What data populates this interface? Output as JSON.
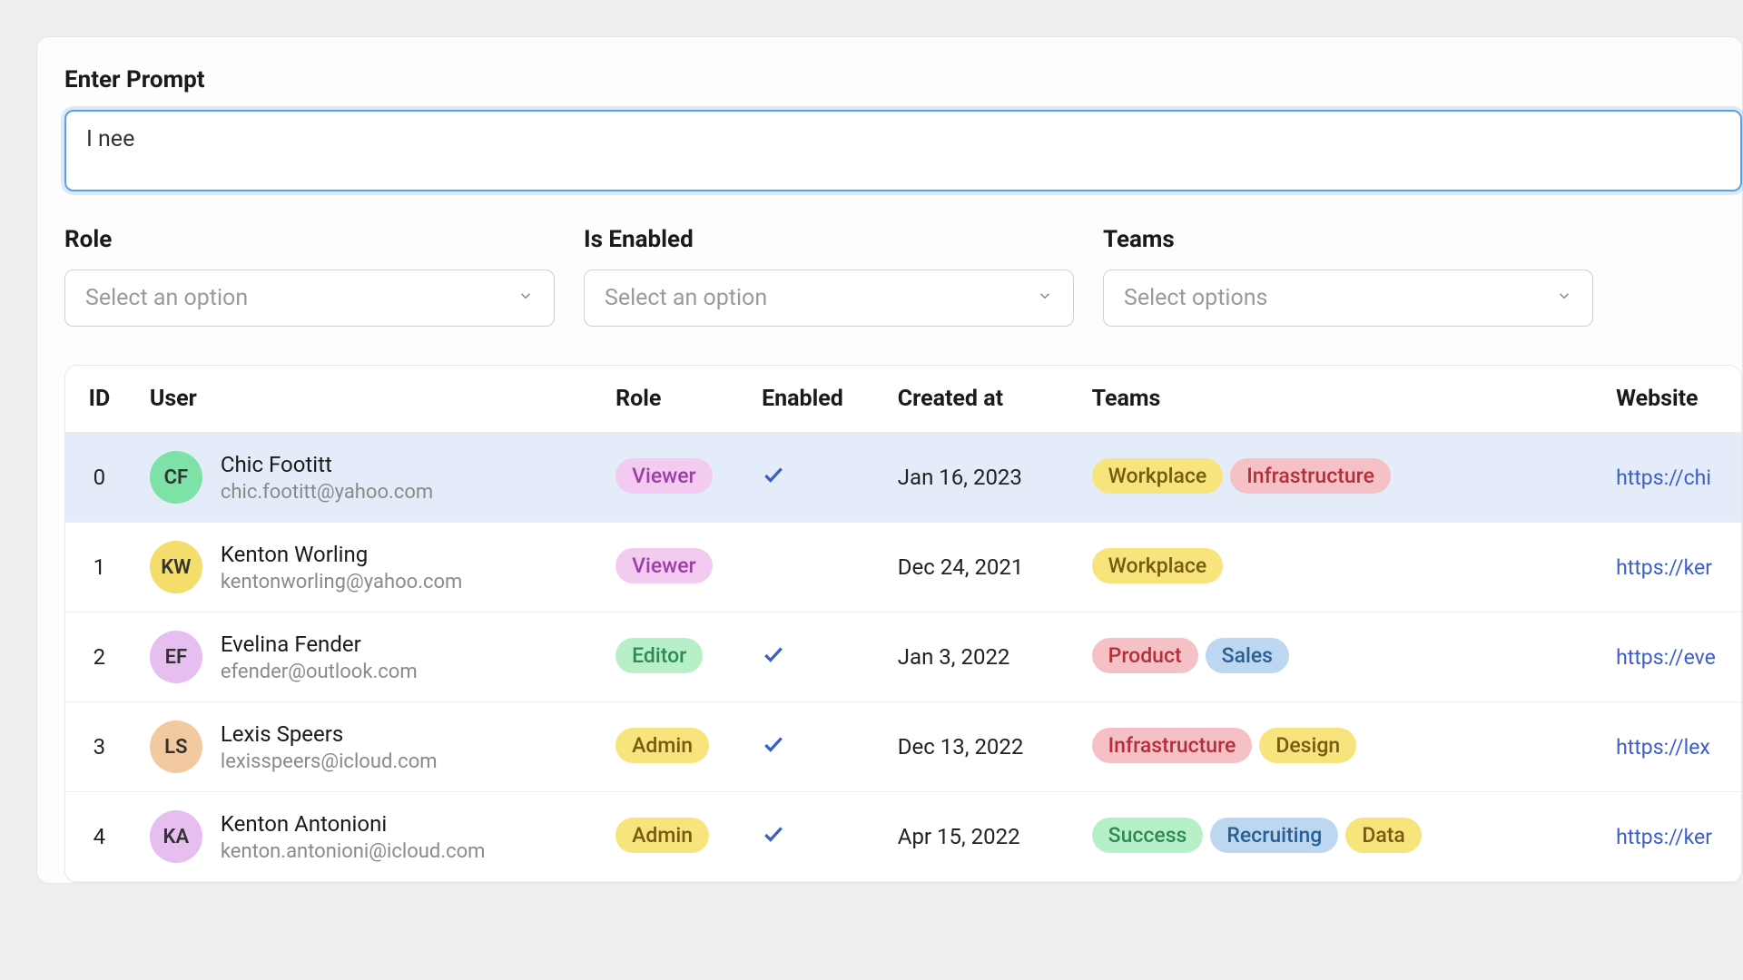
{
  "prompt": {
    "label": "Enter Prompt",
    "value": "I nee"
  },
  "filters": {
    "role": {
      "label": "Role",
      "placeholder": "Select an option"
    },
    "enabled": {
      "label": "Is Enabled",
      "placeholder": "Select an option"
    },
    "teams": {
      "label": "Teams",
      "placeholder": "Select options"
    }
  },
  "table": {
    "headers": {
      "id": "ID",
      "user": "User",
      "role": "Role",
      "enabled": "Enabled",
      "created": "Created at",
      "teams": "Teams",
      "website": "Website"
    },
    "rows": [
      {
        "id": "0",
        "initials": "CF",
        "avatar_bg": "#7ee2a8",
        "name": "Chic Footitt",
        "email": "chic.footitt@yahoo.com",
        "role": "Viewer",
        "role_bg": "#f3cbf0",
        "role_fg": "#9b3fa5",
        "enabled": true,
        "created": "Jan 16, 2023",
        "teams": [
          {
            "label": "Workplace",
            "bg": "#f7e47c",
            "fg": "#7a5a10"
          },
          {
            "label": "Infrastructure",
            "bg": "#f6c0c7",
            "fg": "#b3303b"
          }
        ],
        "website": "https://chi",
        "selected": true
      },
      {
        "id": "1",
        "initials": "KW",
        "avatar_bg": "#f4dd6b",
        "name": "Kenton Worling",
        "email": "kentonworling@yahoo.com",
        "role": "Viewer",
        "role_bg": "#f3cbf0",
        "role_fg": "#9b3fa5",
        "enabled": false,
        "created": "Dec 24, 2021",
        "teams": [
          {
            "label": "Workplace",
            "bg": "#f7e47c",
            "fg": "#7a5a10"
          }
        ],
        "website": "https://ker",
        "selected": false
      },
      {
        "id": "2",
        "initials": "EF",
        "avatar_bg": "#e6bff0",
        "name": "Evelina Fender",
        "email": "efender@outlook.com",
        "role": "Editor",
        "role_bg": "#b7f0c8",
        "role_fg": "#2f8a52",
        "enabled": true,
        "created": "Jan 3, 2022",
        "teams": [
          {
            "label": "Product",
            "bg": "#f6c0c7",
            "fg": "#b3303b"
          },
          {
            "label": "Sales",
            "bg": "#bcd7ef",
            "fg": "#2a5f95"
          }
        ],
        "website": "https://eve",
        "selected": false
      },
      {
        "id": "3",
        "initials": "LS",
        "avatar_bg": "#f3c9a0",
        "name": "Lexis Speers",
        "email": "lexisspeers@icloud.com",
        "role": "Admin",
        "role_bg": "#f7e47c",
        "role_fg": "#7a5a10",
        "enabled": true,
        "created": "Dec 13, 2022",
        "teams": [
          {
            "label": "Infrastructure",
            "bg": "#f6c0c7",
            "fg": "#b3303b"
          },
          {
            "label": "Design",
            "bg": "#f7e47c",
            "fg": "#7a5a10"
          }
        ],
        "website": "https://lex",
        "selected": false
      },
      {
        "id": "4",
        "initials": "KA",
        "avatar_bg": "#e6bff0",
        "name": "Kenton Antonioni",
        "email": "kenton.antonioni@icloud.com",
        "role": "Admin",
        "role_bg": "#f7e47c",
        "role_fg": "#7a5a10",
        "enabled": true,
        "created": "Apr 15, 2022",
        "teams": [
          {
            "label": "Success",
            "bg": "#b7f0c8",
            "fg": "#2f8a52"
          },
          {
            "label": "Recruiting",
            "bg": "#bcd7ef",
            "fg": "#2a5f95"
          },
          {
            "label": "Data",
            "bg": "#f7e47c",
            "fg": "#7a5a10"
          }
        ],
        "website": "https://ker",
        "selected": false
      }
    ]
  }
}
